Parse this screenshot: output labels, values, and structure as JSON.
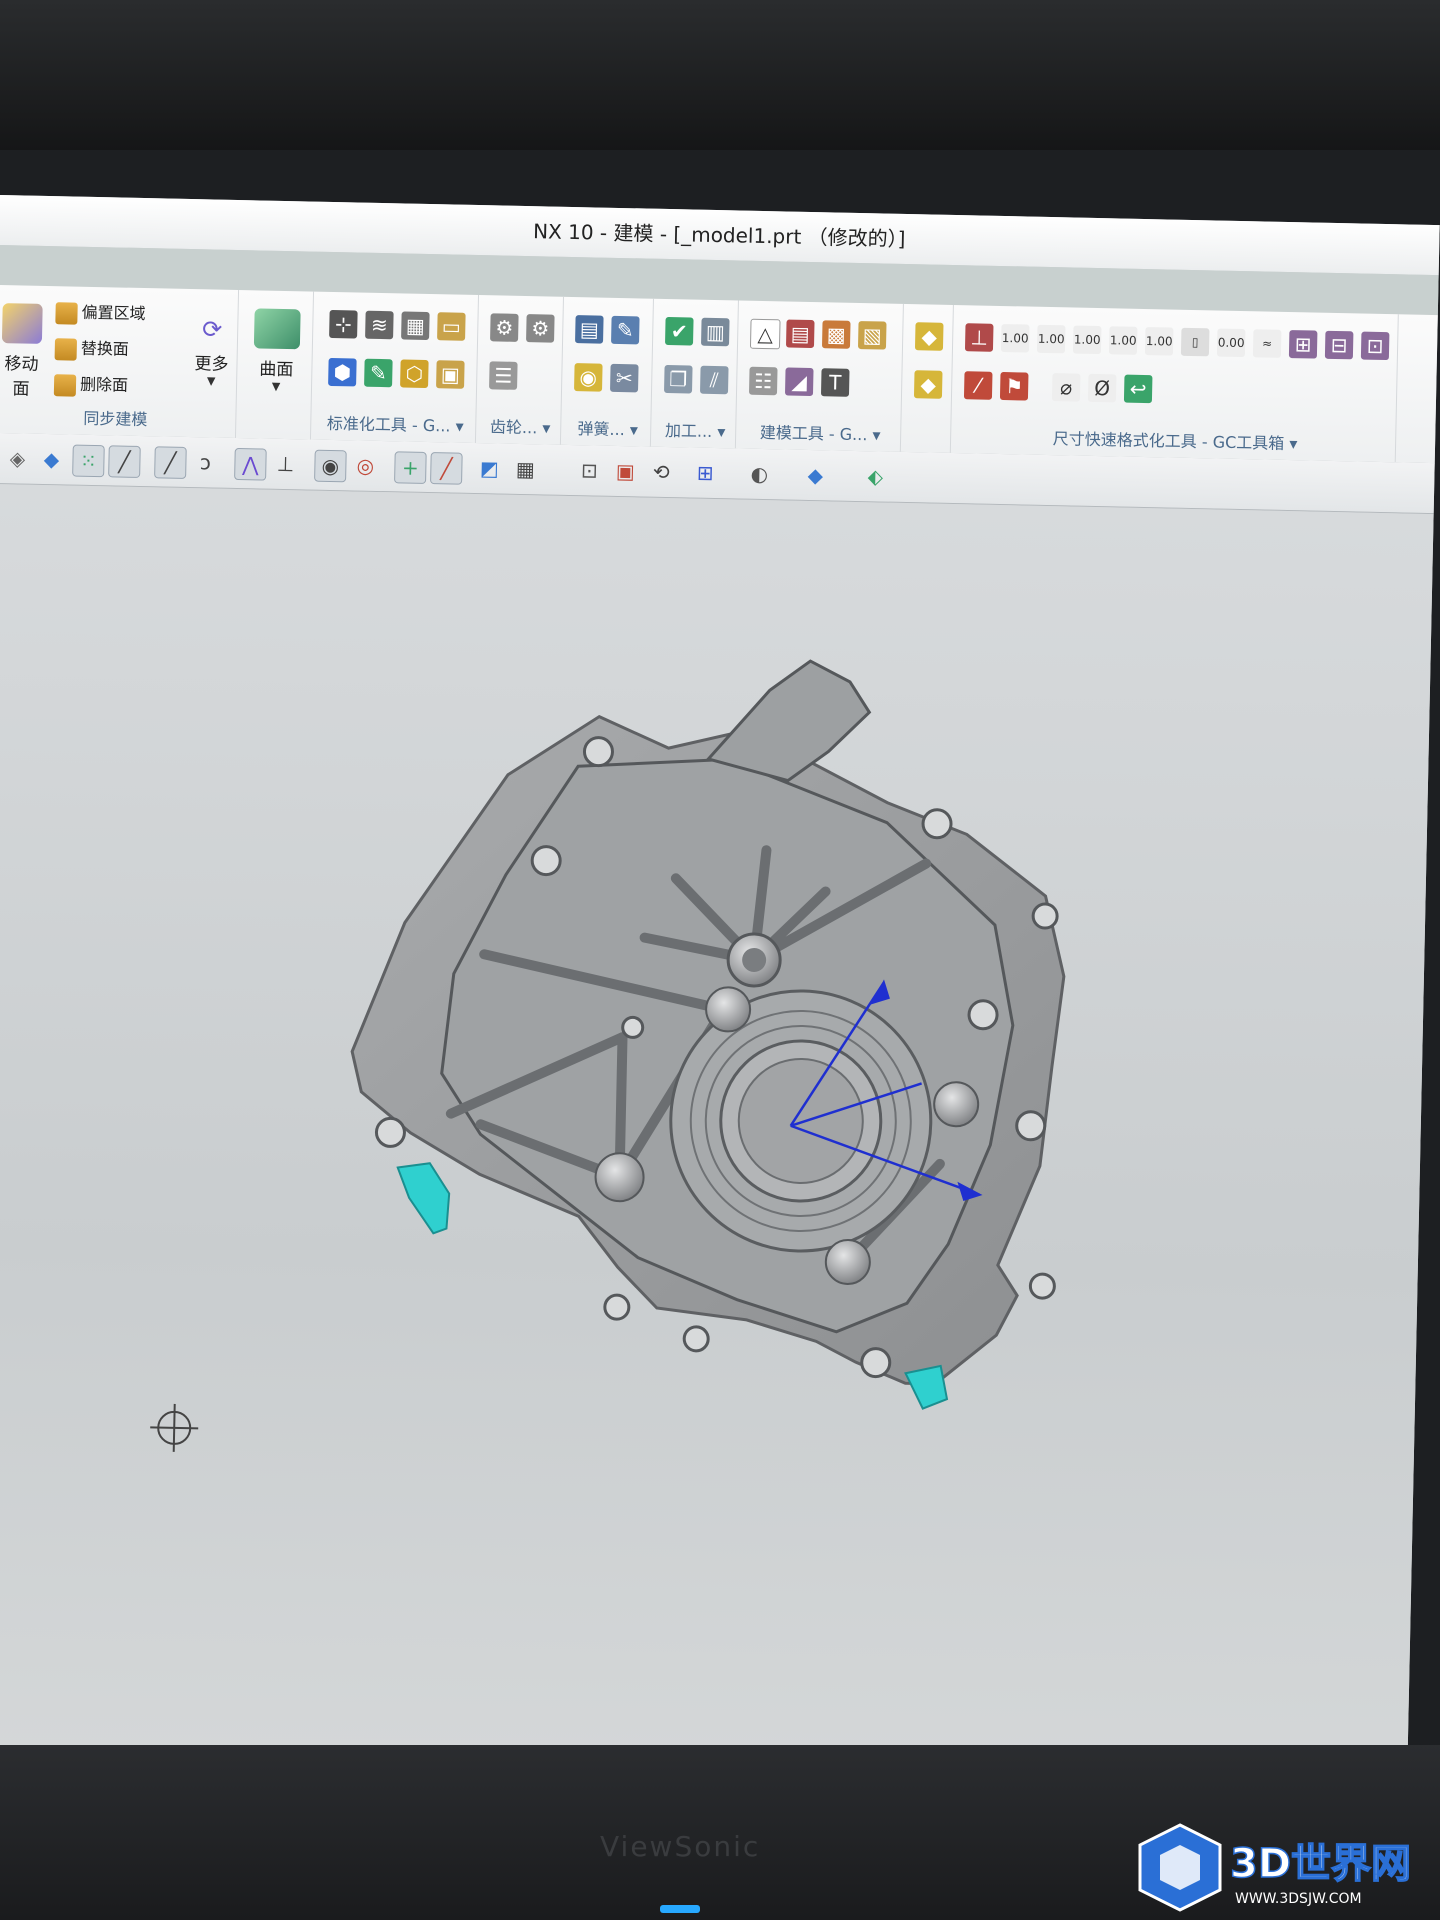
{
  "window": {
    "title": "NX 10 - 建模 - [_model1.prt （修改的）]"
  },
  "ribbon": {
    "sync_group": {
      "move_face": "移动面",
      "offset_region": "偏置区域",
      "replace_face": "替换面",
      "delete_face": "删除面",
      "more": "更多",
      "label": "同步建模"
    },
    "surface": {
      "label": "曲面"
    },
    "groups": [
      {
        "label": "标准化工具 - G..."
      },
      {
        "label": "齿轮..."
      },
      {
        "label": "弹簧..."
      },
      {
        "label": "加工..."
      },
      {
        "label": "建模工具 - G..."
      },
      {
        "label": "尺寸快速格式化工具 - GC工具箱"
      }
    ]
  },
  "viewport": {
    "model_name": "housing-cover",
    "highlight_color": "#2fd0cf",
    "csys_color": "#1f2fd0"
  },
  "branding": {
    "monitor": "ViewSonic",
    "watermark_main": "3D世界网",
    "watermark_url": "WWW.3DSJW.COM"
  },
  "colors": {
    "titlebar": "#ffffff",
    "ribbon_label": "#4a6a8c"
  }
}
